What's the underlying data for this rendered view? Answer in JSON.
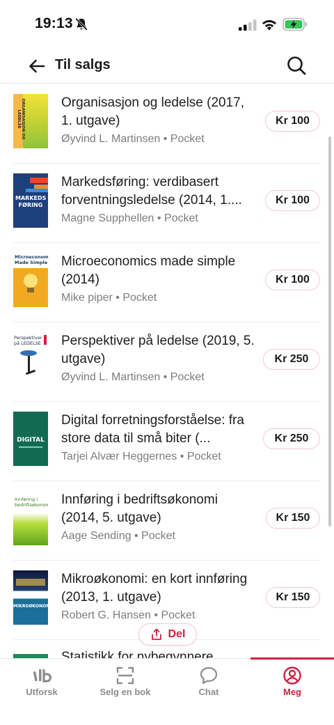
{
  "status_bar": {
    "time": "19:13"
  },
  "header": {
    "title": "Til salgs"
  },
  "books": [
    {
      "title": "Organisasjon og ledelse (2017, 1. utgave)",
      "author": "Øyvind L. Martinsen",
      "format": "Pocket",
      "price": "Kr 100",
      "cover_text": "ORGANISASJON OG LEDELSE",
      "cover_color": "#d6d532"
    },
    {
      "title": "Markedsføring: verdibasert forventningsledelse (2014, 1....",
      "author": "Magne Supphellen",
      "format": "Pocket",
      "price": "Kr 100",
      "cover_text": "MARKEDS FØRING",
      "cover_color": "#1d3f7c"
    },
    {
      "title": "Microeconomics made simple (2014)",
      "author": "Mike piper",
      "format": "Pocket",
      "price": "Kr 100",
      "cover_text": "Microeconomics Made Simple",
      "cover_color": "#f2a922"
    },
    {
      "title": "Perspektiver på ledelse (2019, 5. utgave)",
      "author": "Øyvind L. Martinsen",
      "format": "Pocket",
      "price": "Kr 250",
      "cover_text": "Perspektiver på LEDELSE",
      "cover_color": "#ffffff"
    },
    {
      "title": "Digital forretningsforståelse: fra store data til små biter (...",
      "author": "Tarjei Alvær Heggernes",
      "format": "Pocket",
      "price": "Kr 250",
      "cover_text": "DIGITAL",
      "cover_color": "#136a52"
    },
    {
      "title": "Innføring i bedriftsøkonomi (2014, 5. utgave)",
      "author": "Aage Sending",
      "format": "Pocket",
      "price": "Kr 150",
      "cover_text": "Innføring i bedriftsøkonomi",
      "cover_color": "#7fbf22"
    },
    {
      "title": "Mikroøkonomi: en kort innføring (2013, 1. utgave)",
      "author": "Robert G. Hansen",
      "format": "Pocket",
      "price": "Kr 150",
      "cover_text": "MIKROØKONOMI",
      "cover_color": "#1b6f9a"
    },
    {
      "title": "Statistikk for nybegynnere",
      "author": "",
      "format": "",
      "price": "",
      "cover_text": "",
      "cover_color": "#1f8a5a"
    }
  ],
  "separator": "•",
  "share": {
    "label": "Del"
  },
  "tabs": [
    {
      "label": "Utforsk",
      "icon": "explore-icon"
    },
    {
      "label": "Selg en bok",
      "icon": "scan-icon"
    },
    {
      "label": "Chat",
      "icon": "chat-icon"
    },
    {
      "label": "Meg",
      "icon": "profile-icon",
      "active": true
    }
  ],
  "colors": {
    "accent": "#d0213f",
    "price_border": "#f3c9cf",
    "muted_text": "#7d7d7d",
    "battery_green": "#34c759"
  }
}
